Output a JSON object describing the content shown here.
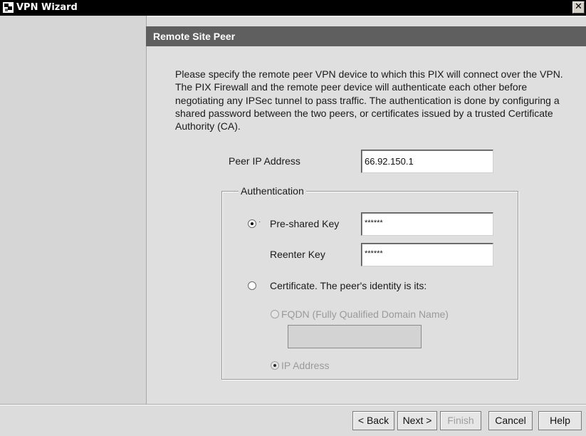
{
  "window": {
    "title": "VPN Wizard",
    "close_glyph": "✕"
  },
  "header": {
    "title": "Remote Site Peer"
  },
  "description": "Please specify the remote peer VPN device to which this PIX will connect over the VPN. The PIX Firewall and the remote peer device will authenticate each other before negotiating any IPSec tunnel to pass traffic. The authentication is done by configuring a shared password between the two peers, or certificates issued by a trusted Certificate Authority (CA).",
  "peer": {
    "label": "Peer IP Address",
    "value": "66.92.150.1"
  },
  "authentication": {
    "legend": "Authentication",
    "preshared": {
      "label": "Pre-shared Key",
      "value": "******",
      "selected": true
    },
    "reenter": {
      "label": "Reenter Key",
      "value": "******"
    },
    "certificate": {
      "label": "Certificate. The peer's identity is its:",
      "selected": false
    },
    "fqdn": {
      "label": "FQDN (Fully Qualified Domain Name)",
      "value": "",
      "selected": false
    },
    "ip_address": {
      "label": "IP Address",
      "selected": true
    }
  },
  "buttons": {
    "back": "< Back",
    "next": "Next >",
    "finish": "Finish",
    "cancel": "Cancel",
    "help": "Help"
  },
  "icons": {
    "app": "vpn-wizard-app-icon",
    "close": "close-icon"
  }
}
